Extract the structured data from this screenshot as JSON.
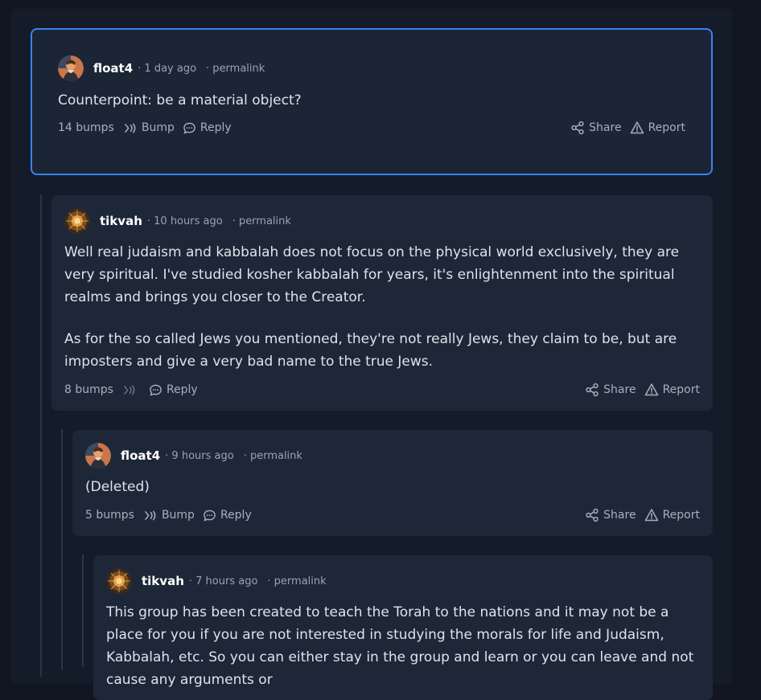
{
  "comments": [
    {
      "author": "float4",
      "time": "· 1 day ago",
      "permalink": "· permalink",
      "paragraphs": [
        "Counterpoint: be a material object?"
      ],
      "bumps": "14 bumps",
      "bump_label": "Bump",
      "reply_label": "Reply",
      "share_label": "Share",
      "report_label": "Report",
      "highlighted": true
    },
    {
      "author": "tikvah",
      "time": "· 10 hours ago",
      "permalink": "· permalink",
      "paragraphs": [
        "Well real judaism and kabbalah does not focus on the physical world exclusively, they are very spiritual.  I've studied kosher kabbalah for years, it's enlightenment into the spiritual realms and brings you closer to the Creator.",
        "As for the so called Jews you mentioned, they're not really Jews, they claim to be, but are imposters and give a very bad name to the true Jews."
      ],
      "bumps": "8 bumps",
      "reply_label": "Reply",
      "share_label": "Share",
      "report_label": "Report"
    },
    {
      "author": "float4",
      "time": "· 9 hours ago",
      "permalink": "· permalink",
      "paragraphs": [
        "(Deleted)"
      ],
      "bumps": "5 bumps",
      "bump_label": "Bump",
      "reply_label": "Reply",
      "share_label": "Share",
      "report_label": "Report"
    },
    {
      "author": "tikvah",
      "time": "· 7 hours ago",
      "permalink": "· permalink",
      "paragraphs": [
        "This group has been created to teach the Torah to the nations and it may not be a place for you if you are not interested in studying the morals for life and Judaism, Kabbalah, etc.  So you can either stay in the group and learn or you can leave and not cause any arguments or"
      ]
    }
  ],
  "icons": {
    "bump": "bump-signal-icon",
    "reply": "chat-bubble-icon",
    "share": "share-nodes-icon",
    "report": "warning-triangle-icon"
  },
  "colors": {
    "highlight_border": "#3b82f6",
    "card": "#1e2738",
    "background": "#111622"
  }
}
